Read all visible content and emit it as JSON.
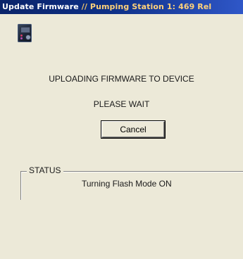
{
  "window": {
    "title_prefix": "Update Firmware",
    "title_separator": " // ",
    "title_station": "Pumping Station 1: 469 Rel"
  },
  "icon": {
    "name": "relay-device-icon"
  },
  "messages": {
    "uploading": "UPLOADING FIRMWARE TO DEVICE",
    "wait": "PLEASE WAIT"
  },
  "buttons": {
    "cancel_label": "Cancel"
  },
  "status": {
    "legend": "STATUS",
    "text": "Turning Flash Mode ON"
  },
  "colors": {
    "titlebar_start": "#0a246a",
    "titlebar_end": "#2f57c8",
    "title_accent": "#ffd27a",
    "dialog_background": "#ece9d8"
  }
}
